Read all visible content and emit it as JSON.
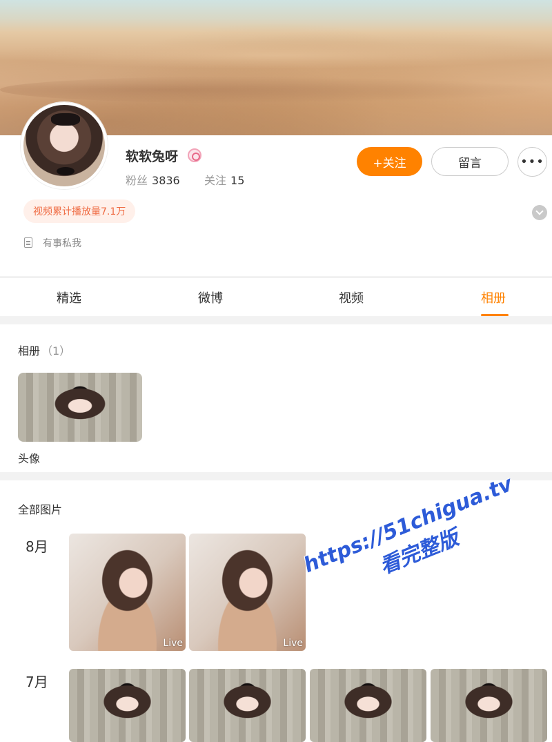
{
  "profile": {
    "username": "软软兔呀",
    "fans_label": "粉丝",
    "fans_count": "3836",
    "following_label": "关注",
    "following_count": "15",
    "follow_button": "+关注",
    "message_button": "留言",
    "more_button": "•••",
    "play_badge": "视频累计播放量7.1万",
    "bio": "有事私我"
  },
  "tabs": [
    {
      "label": "精选",
      "active": false
    },
    {
      "label": "微博",
      "active": false
    },
    {
      "label": "视频",
      "active": false
    },
    {
      "label": "相册",
      "active": true
    }
  ],
  "album_section": {
    "title": "相册",
    "count": "（1）",
    "albums": [
      {
        "label": "头像"
      }
    ]
  },
  "photos_section": {
    "title": "全部图片",
    "groups": [
      {
        "month": "8月",
        "photos": [
          {
            "badge": "Live"
          },
          {
            "badge": "Live"
          }
        ]
      },
      {
        "month": "7月",
        "photos": [
          {},
          {},
          {},
          {}
        ]
      }
    ]
  },
  "watermark": {
    "line1": "https://51chigua.tv",
    "line2": "看完整版"
  },
  "colors": {
    "accent": "#ff8200",
    "badge_text": "#ef6b43",
    "badge_bg": "#fff0ea",
    "watermark": "#2d5bd8"
  }
}
